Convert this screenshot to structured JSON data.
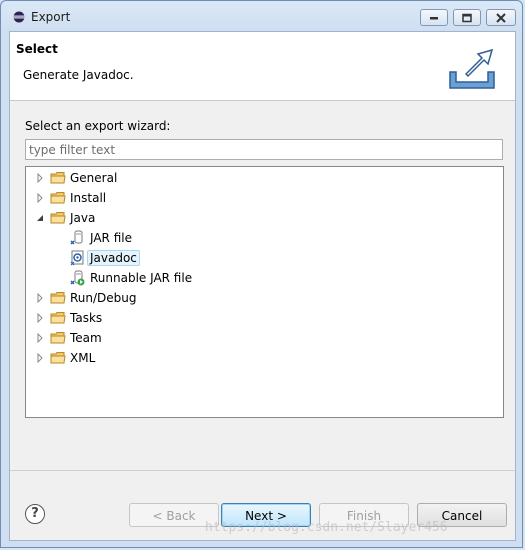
{
  "window": {
    "title": "Export",
    "controls": [
      "minimize-icon",
      "maximize-icon",
      "close-icon"
    ]
  },
  "header": {
    "title": "Select",
    "description": "Generate Javadoc."
  },
  "wizard": {
    "label": "Select an export wizard:",
    "filter_placeholder": "type filter text",
    "tree": [
      {
        "label": "General",
        "expanded": false,
        "icon": "folder-icon"
      },
      {
        "label": "Install",
        "expanded": false,
        "icon": "folder-icon"
      },
      {
        "label": "Java",
        "expanded": true,
        "icon": "folder-icon",
        "children": [
          {
            "label": "JAR file",
            "icon": "jar-file-icon"
          },
          {
            "label": "Javadoc",
            "icon": "javadoc-icon",
            "selected": true
          },
          {
            "label": "Runnable JAR file",
            "icon": "runnable-jar-icon"
          }
        ]
      },
      {
        "label": "Run/Debug",
        "expanded": false,
        "icon": "folder-icon"
      },
      {
        "label": "Tasks",
        "expanded": false,
        "icon": "folder-icon"
      },
      {
        "label": "Team",
        "expanded": false,
        "icon": "folder-icon"
      },
      {
        "label": "XML",
        "expanded": false,
        "icon": "folder-icon"
      }
    ]
  },
  "buttons": {
    "back": "< Back",
    "next": "Next >",
    "finish": "Finish",
    "cancel": "Cancel"
  },
  "watermark": "https://blog.csdn.net/Slayer456"
}
